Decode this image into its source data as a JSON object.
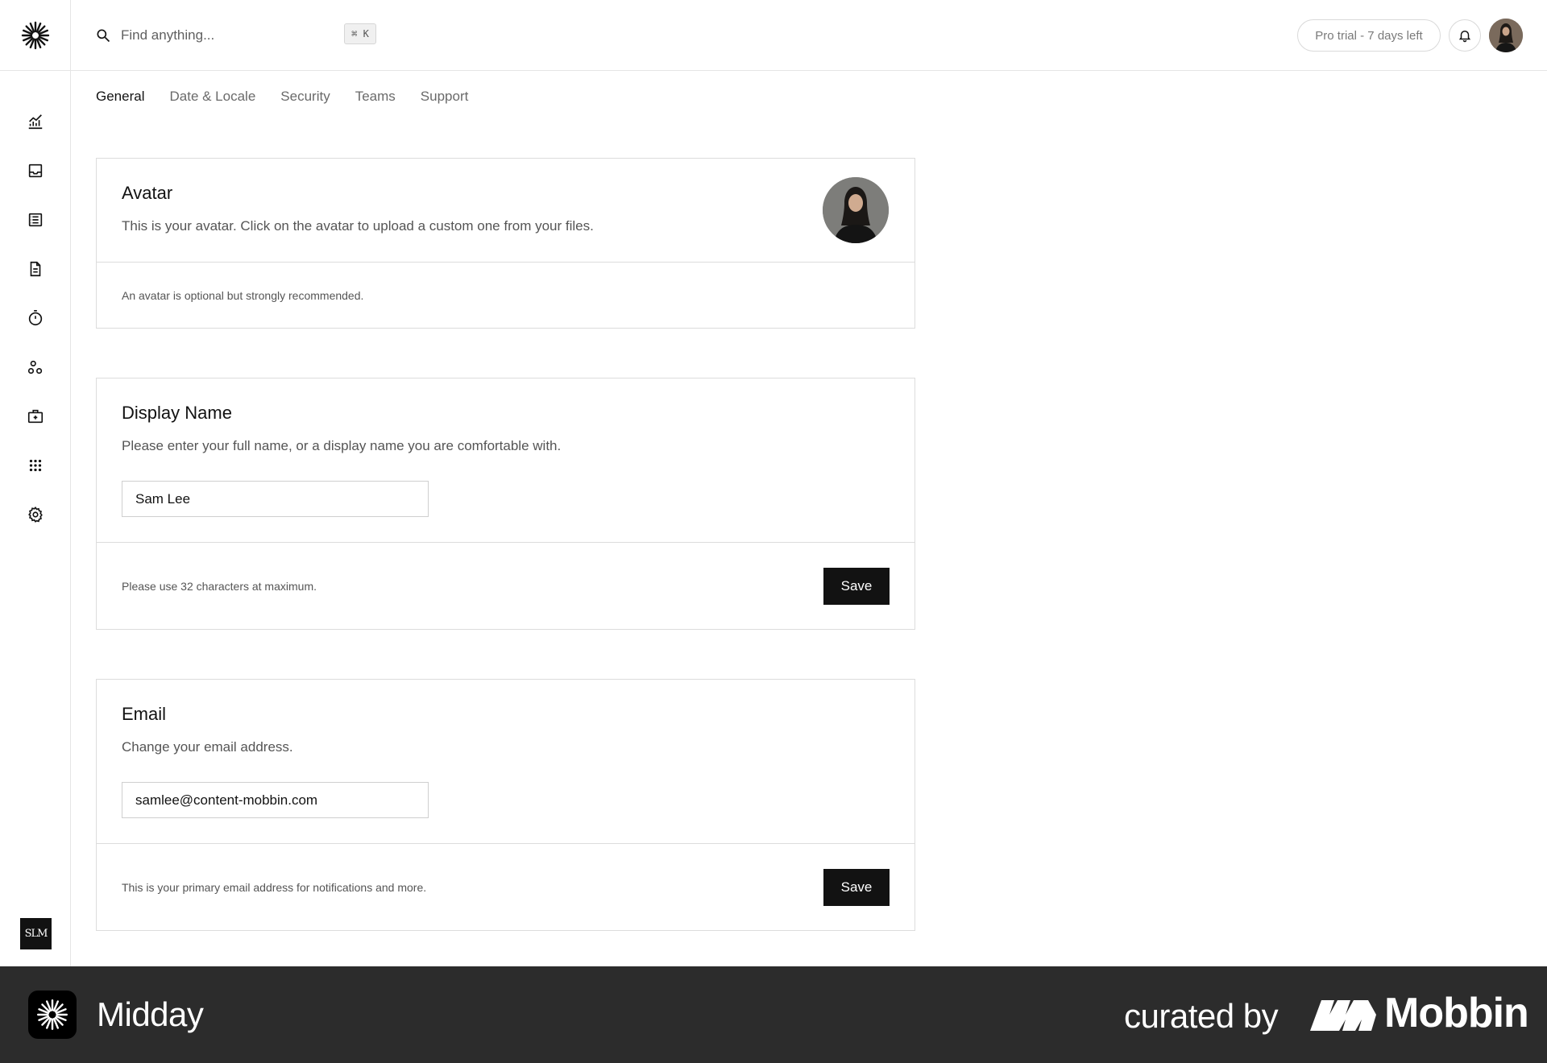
{
  "header": {
    "search_placeholder": "Find anything...",
    "search_shortcut": "⌘ K",
    "trial_label": "Pro trial - 7 days left"
  },
  "sidebar": {
    "items": [
      {
        "icon": "chart-icon"
      },
      {
        "icon": "inbox-icon"
      },
      {
        "icon": "transactions-icon"
      },
      {
        "icon": "invoice-icon"
      },
      {
        "icon": "timer-icon"
      },
      {
        "icon": "customers-icon"
      },
      {
        "icon": "vault-icon"
      },
      {
        "icon": "apps-icon"
      },
      {
        "icon": "settings-icon"
      }
    ],
    "team_badge": "SLM"
  },
  "tabs": [
    {
      "label": "General",
      "active": true
    },
    {
      "label": "Date & Locale",
      "active": false
    },
    {
      "label": "Security",
      "active": false
    },
    {
      "label": "Teams",
      "active": false
    },
    {
      "label": "Support",
      "active": false
    }
  ],
  "avatar_card": {
    "title": "Avatar",
    "description": "This is your avatar. Click on the avatar to upload a custom one from your files.",
    "footer": "An avatar is optional but strongly recommended."
  },
  "display_name_card": {
    "title": "Display Name",
    "description": "Please enter your full name, or a display name you are comfortable with.",
    "value": "Sam Lee",
    "footer": "Please use 32 characters at maximum.",
    "save_label": "Save"
  },
  "email_card": {
    "title": "Email",
    "description": "Change your email address.",
    "value": "samlee@content-mobbin.com",
    "footer": "This is your primary email address for notifications and more.",
    "save_label": "Save"
  },
  "brandbar": {
    "app_name": "Midday",
    "curated_by": "curated by",
    "mobbin": "Mobbin"
  },
  "colors": {
    "accent": "#121212",
    "border": "#dcdcdc",
    "brandbar_bg": "#2c2c2c"
  }
}
